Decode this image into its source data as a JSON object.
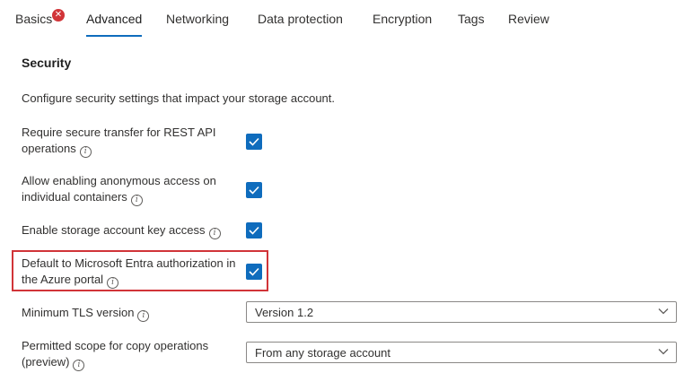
{
  "tabs": [
    {
      "label": "Basics",
      "has_error": true
    },
    {
      "label": "Advanced",
      "active": true
    },
    {
      "label": "Networking"
    },
    {
      "label": "Data protection"
    },
    {
      "label": "Encryption"
    },
    {
      "label": "Tags"
    },
    {
      "label": "Review"
    }
  ],
  "error_badge": "✕",
  "section": {
    "title": "Security",
    "description": "Configure security settings that impact your storage account."
  },
  "settings": [
    {
      "label_line1": "Require secure transfer for REST API",
      "label_line2": "operations",
      "checked": true
    },
    {
      "label_line1": "Allow enabling anonymous access on",
      "label_line2": "individual containers",
      "checked": true
    },
    {
      "label_line1": "Enable storage account key access",
      "label_line2": "",
      "checked": true
    },
    {
      "label_line1": "Default to Microsoft Entra authorization in",
      "label_line2": "the Azure portal",
      "checked": true
    }
  ],
  "tls": {
    "label": "Minimum TLS version",
    "value": "Version 1.2"
  },
  "copy_scope": {
    "label_line1": "Permitted scope for copy operations",
    "label_line2": "(preview)",
    "value": "From any storage account"
  },
  "info_glyph": "i",
  "colors": {
    "accent": "#0f6cbd",
    "error": "#d13438",
    "highlight": "#d13438"
  }
}
